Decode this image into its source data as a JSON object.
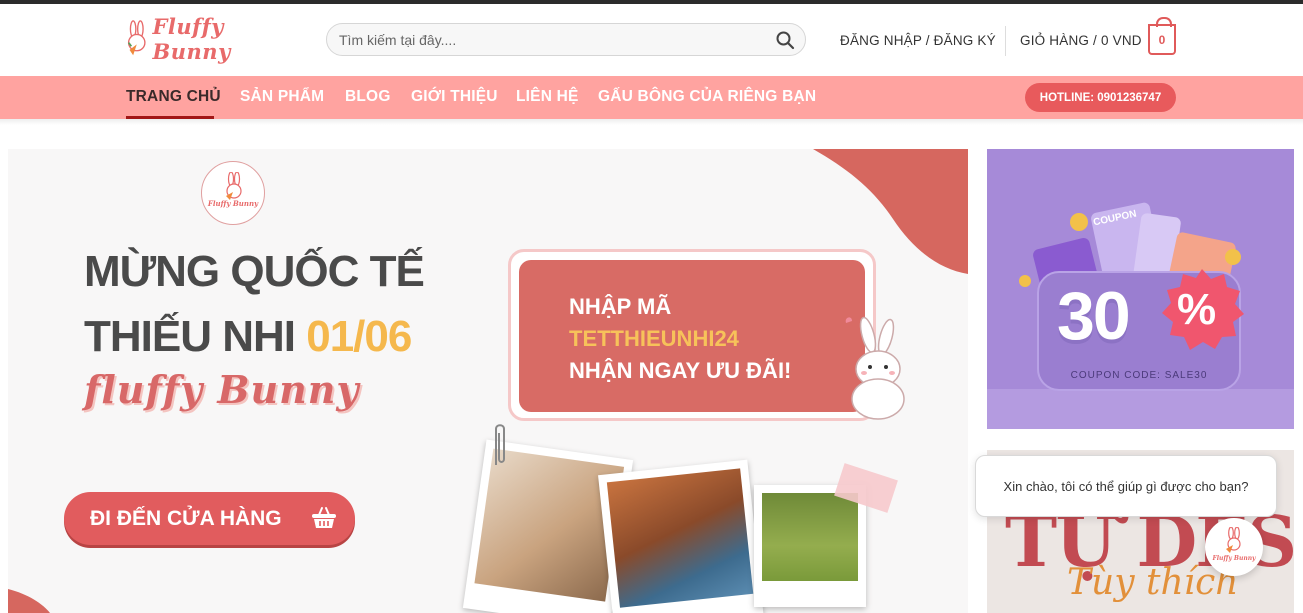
{
  "brand": {
    "logo_text": "Fluffy Bunny",
    "accent": "#ffa3a0",
    "primary": "#e15c5e"
  },
  "search": {
    "placeholder": "Tìm kiếm tại đây...."
  },
  "header": {
    "account_label": "ĐĂNG NHẬP / ĐĂNG KÝ",
    "cart_label": "GIỎ HÀNG / 0 VND",
    "cart_count": "0"
  },
  "nav": {
    "items": [
      {
        "label": "TRANG CHỦ",
        "active": true
      },
      {
        "label": "SẢN PHẨM"
      },
      {
        "label": "BLOG"
      },
      {
        "label": "GIỚI THIỆU"
      },
      {
        "label": "LIÊN HỆ"
      },
      {
        "label": "GẤU BÔNG CỦA RIÊNG BẠN"
      }
    ],
    "hotline": "HOTLINE: 0901236747"
  },
  "banner": {
    "badge_text": "Fluffy Bunny",
    "headline_1": "MỪNG QUỐC TẾ",
    "headline_2": "THIẾU NHI ",
    "headline_date": "01/06",
    "script_brand": "fluffy Bunny",
    "promo_line_1": "NHẬP MÃ",
    "promo_code": "TETTHIEUNHI24",
    "promo_line_3": "NHẬN NGAY ƯU ĐÃI!",
    "cta": "ĐI ĐẾN CỬA HÀNG"
  },
  "coupon_banner": {
    "label": "COUPON",
    "discount": "30",
    "percent": "%",
    "code": "COUPON CODE: SALE30"
  },
  "design_banner": {
    "title": "TỰ DESIGN",
    "subtitle": "Tùy thích"
  },
  "chat": {
    "greeting": "Xin chào, tôi có thể giúp gì được cho bạn?",
    "avatar_text": "Fluffy Bunny"
  }
}
